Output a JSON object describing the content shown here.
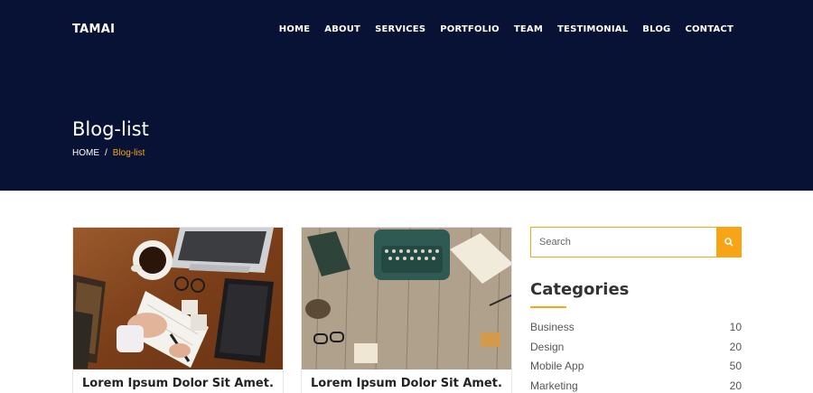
{
  "header": {
    "brand": "TAMAI",
    "nav": [
      "HOME",
      "ABOUT",
      "SERVICES",
      "PORTFOLIO",
      "TEAM",
      "TESTIMONIAL",
      "BLOG",
      "CONTACT"
    ]
  },
  "hero": {
    "title": "Blog-list",
    "breadcrumb": {
      "home": "HOME",
      "separator": "/",
      "current": "Blog-list"
    }
  },
  "posts": [
    {
      "title": "Lorem Ipsum Dolor Sit Amet."
    },
    {
      "title": "Lorem Ipsum Dolor Sit Amet."
    }
  ],
  "sidebar": {
    "search": {
      "placeholder": "Search"
    },
    "categories_title": "Categories",
    "categories": [
      {
        "name": "Business",
        "count": "10"
      },
      {
        "name": "Design",
        "count": "20"
      },
      {
        "name": "Mobile App",
        "count": "50"
      },
      {
        "name": "Marketing",
        "count": "20"
      }
    ]
  },
  "colors": {
    "hero_bg": "#071235",
    "accent": "#f7a416"
  },
  "icons": {
    "search_button": "search-icon"
  }
}
